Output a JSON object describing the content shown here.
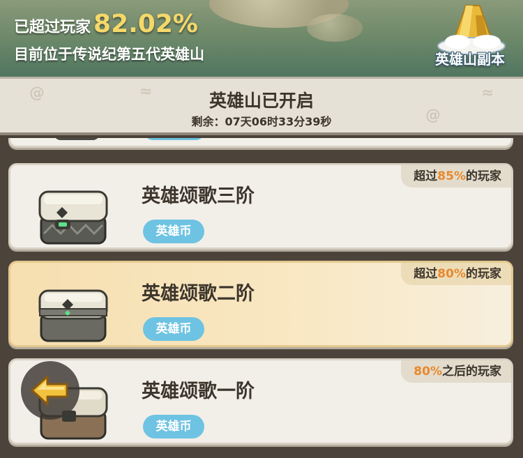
{
  "rank": {
    "prefix": "已超过玩家",
    "percent": "82.02%",
    "location": "目前位于传说纪第五代英雄山"
  },
  "dungeon_button": {
    "label": "英雄山副本"
  },
  "event": {
    "title": "英雄山已开启",
    "countdown": "剩余：07天06时33分39秒"
  },
  "tiers": [
    {
      "name": "英雄颂歌三阶",
      "currency": "英雄币",
      "tag_pre": "超过",
      "tag_pct": "85%",
      "tag_post": "的玩家",
      "highlight": false
    },
    {
      "name": "英雄颂歌二阶",
      "currency": "英雄币",
      "tag_pre": "超过",
      "tag_pct": "80%",
      "tag_post": "的玩家",
      "highlight": true
    },
    {
      "name": "英雄颂歌一阶",
      "currency": "英雄币",
      "tag_pre": "",
      "tag_pct": "80%",
      "tag_post": "之后的玩家",
      "highlight": false
    }
  ],
  "colors": {
    "accent_gold": "#f5d86a",
    "percent_orange": "#e8892c",
    "coin_blue": "#6ec3e2",
    "highlight_card": "#f6dfb0"
  },
  "icons": [
    "chest-icon",
    "back-arrow-icon",
    "dungeon-mountain-icon"
  ]
}
